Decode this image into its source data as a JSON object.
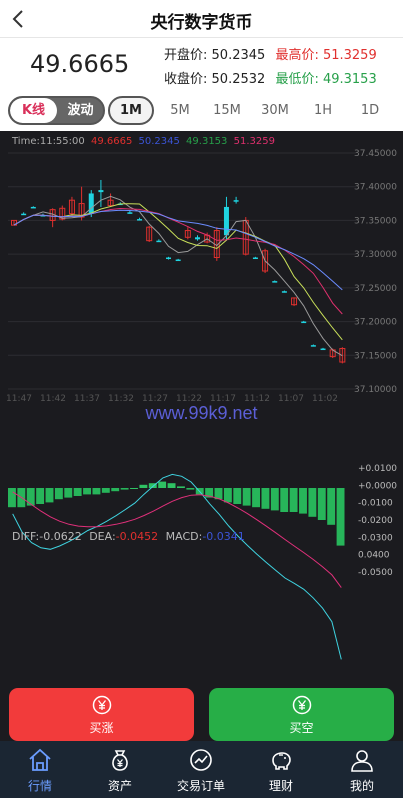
{
  "header": {
    "title": "央行数字货币"
  },
  "quote": {
    "last": "49.6665",
    "open_label": "开盘价:",
    "open": "50.2345",
    "high_label": "最高价:",
    "high": "51.3259",
    "close_label": "收盘价:",
    "close": "50.2532",
    "low_label": "最低价:",
    "low": "49.3153"
  },
  "tabs": {
    "seg_kline": "K线",
    "seg_wave": "波动",
    "timeframes": [
      "1M",
      "5M",
      "15M",
      "30M",
      "1H",
      "1D"
    ],
    "active": "1M"
  },
  "legend": {
    "time": "Time:11:55:00",
    "v1": "49.6665",
    "v2": "50.2345",
    "v3": "49.3153",
    "v4": "51.3259"
  },
  "watermark": "www.99k9.net",
  "macd_legend": {
    "diff_label": "DIFF:",
    "diff": "-0.0622",
    "dea_label": "DEA:",
    "dea": "-0.0452",
    "macd_label": "MACD:",
    "macd": "-0.0341"
  },
  "colors": {
    "up": "#e0302e",
    "down": "#27a04a",
    "cyan": "#1fd3e0",
    "accent_blue": "#6b9dff"
  },
  "chart_data": {
    "type": "candlestick",
    "ylim": [
      37.1,
      37.45
    ],
    "y_ticks": [
      "37.45000",
      "37.40000",
      "37.35000",
      "37.30000",
      "37.25000",
      "37.20000",
      "37.15000",
      "37.10000"
    ],
    "x_ticks": [
      "11:47",
      "11:42",
      "11:37",
      "11:32",
      "11:27",
      "11:22",
      "11:17",
      "11:12",
      "11:07",
      "11:02"
    ],
    "candles": [
      {
        "o": 37.35,
        "c": 37.343,
        "h": 37.35,
        "l": 37.343
      },
      {
        "o": 37.36,
        "c": 37.36,
        "h": 37.362,
        "l": 37.358
      },
      {
        "o": 37.37,
        "c": 37.37,
        "h": 37.371,
        "l": 37.369
      },
      {
        "o": 37.358,
        "c": 37.358,
        "h": 37.36,
        "l": 37.356
      },
      {
        "o": 37.366,
        "c": 37.35,
        "h": 37.368,
        "l": 37.34
      },
      {
        "o": 37.368,
        "c": 37.352,
        "h": 37.372,
        "l": 37.35
      },
      {
        "o": 37.38,
        "c": 37.36,
        "h": 37.385,
        "l": 37.355
      },
      {
        "o": 37.375,
        "c": 37.355,
        "h": 37.4,
        "l": 37.35
      },
      {
        "o": 37.36,
        "c": 37.39,
        "h": 37.395,
        "l": 37.355
      },
      {
        "o": 37.392,
        "c": 37.395,
        "h": 37.41,
        "l": 37.37
      },
      {
        "o": 37.38,
        "c": 37.372,
        "h": 37.39,
        "l": 37.37
      },
      {
        "o": 37.375,
        "c": 37.375,
        "h": 37.377,
        "l": 37.373
      },
      {
        "o": 37.362,
        "c": 37.362,
        "h": 37.364,
        "l": 37.36
      },
      {
        "o": 37.352,
        "c": 37.352,
        "h": 37.354,
        "l": 37.35
      },
      {
        "o": 37.34,
        "c": 37.32,
        "h": 37.342,
        "l": 37.318
      },
      {
        "o": 37.32,
        "c": 37.32,
        "h": 37.322,
        "l": 37.318
      },
      {
        "o": 37.295,
        "c": 37.295,
        "h": 37.296,
        "l": 37.292
      },
      {
        "o": 37.292,
        "c": 37.292,
        "h": 37.293,
        "l": 37.29
      },
      {
        "o": 37.335,
        "c": 37.325,
        "h": 37.34,
        "l": 37.322
      },
      {
        "o": 37.322,
        "c": 37.325,
        "h": 37.328,
        "l": 37.32
      },
      {
        "o": 37.328,
        "c": 37.318,
        "h": 37.332,
        "l": 37.316
      },
      {
        "o": 37.335,
        "c": 37.295,
        "h": 37.34,
        "l": 37.29
      },
      {
        "o": 37.328,
        "c": 37.37,
        "h": 37.385,
        "l": 37.32
      },
      {
        "o": 37.38,
        "c": 37.38,
        "h": 37.385,
        "l": 37.375
      },
      {
        "o": 37.35,
        "c": 37.3,
        "h": 37.355,
        "l": 37.298
      },
      {
        "o": 37.295,
        "c": 37.295,
        "h": 37.296,
        "l": 37.293
      },
      {
        "o": 37.305,
        "c": 37.275,
        "h": 37.308,
        "l": 37.272
      },
      {
        "o": 37.26,
        "c": 37.26,
        "h": 37.261,
        "l": 37.258
      },
      {
        "o": 37.245,
        "c": 37.245,
        "h": 37.246,
        "l": 37.243
      },
      {
        "o": 37.235,
        "c": 37.225,
        "h": 37.236,
        "l": 37.223
      },
      {
        "o": 37.2,
        "c": 37.2,
        "h": 37.201,
        "l": 37.198
      },
      {
        "o": 37.165,
        "c": 37.165,
        "h": 37.166,
        "l": 37.163
      },
      {
        "o": 37.16,
        "c": 37.16,
        "h": 37.161,
        "l": 37.158
      },
      {
        "o": 37.158,
        "c": 37.148,
        "h": 37.16,
        "l": 37.146
      },
      {
        "o": 37.16,
        "c": 37.14,
        "h": 37.162,
        "l": 37.138
      }
    ],
    "macd": {
      "ylim": [
        -0.055,
        0.015
      ],
      "y_ticks": [
        "+0.0100",
        "+0.0000",
        "-0.0100",
        "-0.0200",
        "-0.0300",
        "0.0400",
        "-0.0500"
      ],
      "hist": [
        -0.012,
        -0.012,
        -0.011,
        -0.01,
        -0.009,
        -0.007,
        -0.006,
        -0.005,
        -0.004,
        -0.004,
        -0.003,
        -0.002,
        -0.001,
        0.0,
        0.002,
        0.003,
        0.004,
        0.003,
        0.001,
        -0.001,
        -0.004,
        -0.006,
        -0.007,
        -0.009,
        -0.01,
        -0.011,
        -0.012,
        -0.013,
        -0.014,
        -0.015,
        -0.015,
        -0.016,
        -0.018,
        -0.02,
        -0.023,
        -0.036
      ]
    }
  },
  "actions": {
    "buy_up": "买涨",
    "buy_down": "买空"
  },
  "nav": [
    "行情",
    "资产",
    "交易订单",
    "理财",
    "我的"
  ]
}
